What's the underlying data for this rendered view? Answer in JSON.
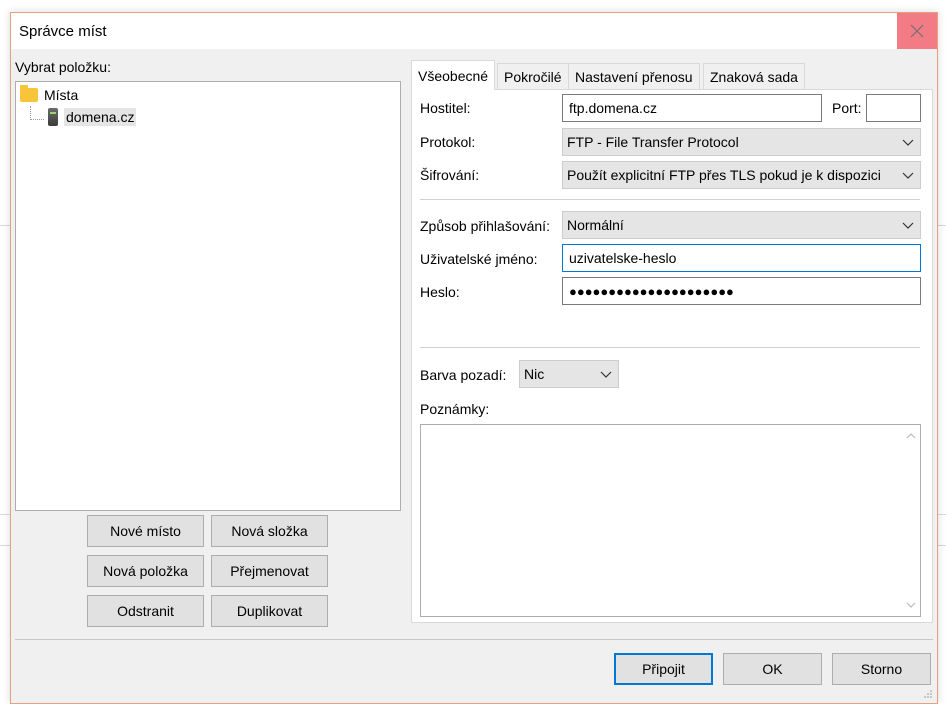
{
  "window": {
    "title": "Správce míst"
  },
  "tree": {
    "label": "Vybrat položku:",
    "root": "Místa",
    "child": "domena.cz"
  },
  "left_buttons": {
    "new_site": "Nové místo",
    "new_folder": "Nová složka",
    "new_item": "Nová položka",
    "rename": "Přejmenovat",
    "delete": "Odstranit",
    "duplicate": "Duplikovat"
  },
  "tabs": [
    {
      "label": "Všeobecné"
    },
    {
      "label": "Pokročilé"
    },
    {
      "label": "Nastavení přenosu"
    },
    {
      "label": "Znaková sada"
    }
  ],
  "form": {
    "host_label": "Hostitel:",
    "host_value": "ftp.domena.cz",
    "port_label": "Port:",
    "port_value": "",
    "protocol_label": "Protokol:",
    "protocol_value": "FTP - File Transfer Protocol",
    "encryption_label": "Šifrování:",
    "encryption_value": "Použít explicitní FTP přes TLS pokud je k dispozici",
    "logon_label": "Způsob přihlašování:",
    "logon_value": "Normální",
    "user_label": "Uživatelské jméno:",
    "user_value": "uzivatelske-heslo",
    "password_label": "Heslo:",
    "password_value": "●●●●●●●●●●●●●●●●●●●●●",
    "bg_label": "Barva pozadí:",
    "bg_value": "Nic",
    "notes_label": "Poznámky:"
  },
  "footer_buttons": {
    "connect": "Připojit",
    "ok": "OK",
    "cancel": "Storno"
  },
  "colors": {
    "accent": "#0078d7",
    "close": "#e81123",
    "window_border": "#e4a37a"
  }
}
